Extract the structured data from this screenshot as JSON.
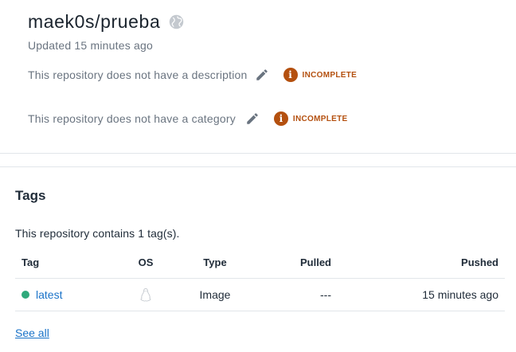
{
  "repo": {
    "name": "maek0s/prueba",
    "visibility_icon": "globe-icon",
    "updated": "Updated 15 minutes ago"
  },
  "meta": {
    "description": {
      "label": "This repository does not have a description",
      "status": "INCOMPLETE"
    },
    "category": {
      "label": "This repository does not have a category",
      "status": "INCOMPLETE"
    }
  },
  "tags_section": {
    "title": "Tags",
    "summary": "This repository contains 1 tag(s).",
    "columns": [
      "Tag",
      "OS",
      "Type",
      "Pulled",
      "Pushed"
    ],
    "rows": [
      {
        "tag": "latest",
        "os_icon": "linux-icon",
        "type": "Image",
        "pulled": "---",
        "pushed": "15 minutes ago"
      }
    ],
    "see_all": "See all"
  },
  "colors": {
    "incomplete": "#b4500f",
    "link": "#1a73c8",
    "tag_dot": "#2fa97b"
  }
}
